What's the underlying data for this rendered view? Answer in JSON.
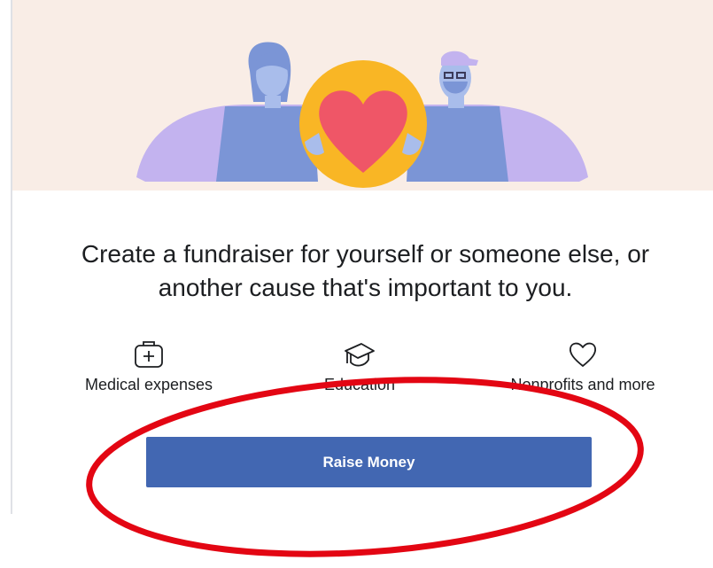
{
  "hero": {
    "illustration": "two-people-holding-heart",
    "colors": {
      "background": "#f9ede6",
      "sleeve": "#c3b3ef",
      "shirt": "#7b95d6",
      "coin": "#f9b625",
      "heart": "#ef5667"
    }
  },
  "headline": {
    "line1": "Create a fundraiser for yourself or someone else, or",
    "line2": "another cause that's important to you."
  },
  "categories": [
    {
      "label": "Medical expenses",
      "icon": "medical-kit-icon"
    },
    {
      "label": "Education",
      "icon": "graduation-cap-icon"
    },
    {
      "label": "Nonprofits and more",
      "icon": "heart-icon"
    }
  ],
  "raise_button": {
    "label": "Raise Money",
    "color": "#4267b2"
  },
  "annotation": {
    "shape": "ellipse",
    "color": "#e30613"
  }
}
